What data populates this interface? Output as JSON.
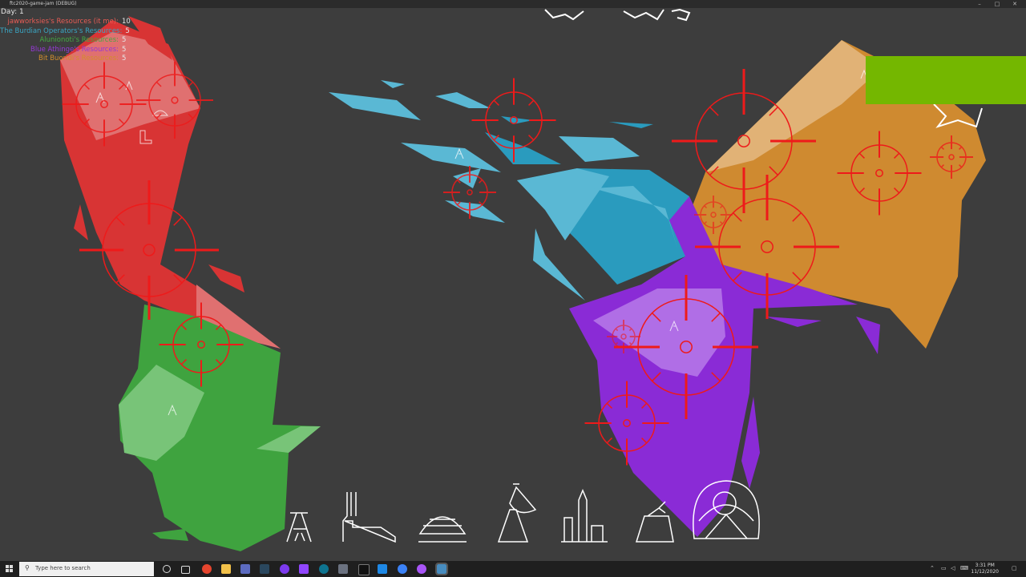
{
  "window": {
    "title": "ftc2020-game-jam (DEBUG)"
  },
  "hud": {
    "day_label": "Day: 1",
    "resources": [
      {
        "label": "jawworksies's Resources (it me):",
        "value": "10",
        "color": "#e85c55"
      },
      {
        "label": "The Burdian Operators's Resources:",
        "value": "5",
        "color": "#3aa6c4"
      },
      {
        "label": "Alunionoti's Resources:",
        "value": "5",
        "color": "#43a943"
      },
      {
        "label": "Blue Athinge's Resources:",
        "value": "5",
        "color": "#9538d6"
      },
      {
        "label": "Bit Buoridi's Resources:",
        "value": "5",
        "color": "#d18e2b"
      }
    ]
  },
  "colors": {
    "background": "#3d3d3d",
    "red_team": "#d83434",
    "blue_team": "#2a9bbe",
    "green_team": "#3fa33f",
    "purple_team": "#8a2bd6",
    "orange_team": "#cf8a30",
    "crosshair": "#ee1a1a",
    "overlay_box": "#74b700"
  },
  "toolbar": {
    "buildings": [
      "oil-derrick-icon",
      "factory-icon",
      "dome-icon",
      "satellite-dish-icon",
      "rocket-silo-icon",
      "cannon-icon",
      "biodome-icon"
    ]
  },
  "taskbar": {
    "search_placeholder": "Type here to search",
    "time": "3:31 PM",
    "date": "11/12/2020"
  }
}
